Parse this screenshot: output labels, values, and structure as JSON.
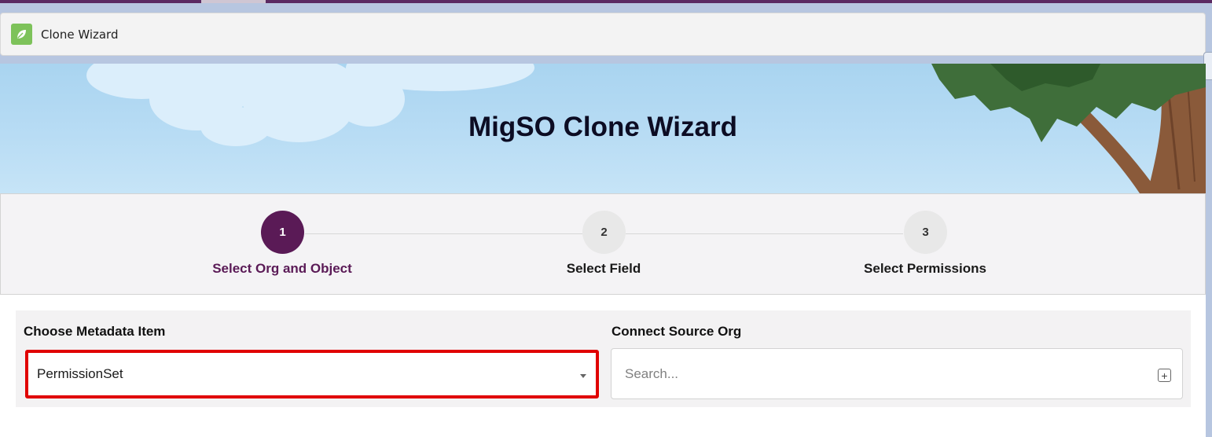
{
  "app": {
    "title": "Clone Wizard",
    "icon": "leaf-icon"
  },
  "banner": {
    "title": "MigSO Clone Wizard"
  },
  "steps": [
    {
      "number": "1",
      "label": "Select Org and Object",
      "active": true
    },
    {
      "number": "2",
      "label": "Select Field",
      "active": false
    },
    {
      "number": "3",
      "label": "Select Permissions",
      "active": false
    }
  ],
  "form": {
    "metadata_label": "Choose Metadata Item",
    "metadata_value": "PermissionSet",
    "source_org_label": "Connect Source Org",
    "source_org_placeholder": "Search...",
    "source_org_value": ""
  },
  "colors": {
    "accent": "#5a1a56",
    "highlight_border": "#e00000",
    "app_icon": "#7dc25a"
  }
}
